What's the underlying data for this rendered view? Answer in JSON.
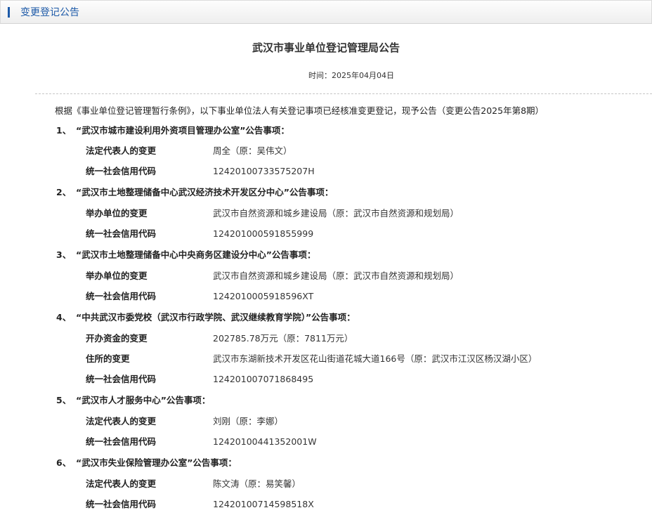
{
  "header": {
    "title": "变更登记公告"
  },
  "article": {
    "title": "武汉市事业单位登记管理局公告",
    "time_label": "时间：",
    "time_value": "2025年04月04日",
    "intro": "根据《事业单位登记管理暂行条例》，以下事业单位法人有关登记事项已经核准变更登记，现予公告（变更公告2025年第8期）",
    "items": [
      {
        "num": "1、",
        "heading": "“武汉市城市建设利用外资项目管理办公室”公告事项：",
        "rows": [
          {
            "label": "法定代表人的变更",
            "value": "周全（原：吴伟文）"
          },
          {
            "label": "统一社会信用代码",
            "value": "12420100733575207H"
          }
        ]
      },
      {
        "num": "2、",
        "heading": "“武汉市土地整理储备中心武汉经济技术开发区分中心”公告事项：",
        "rows": [
          {
            "label": "举办单位的变更",
            "value": "武汉市自然资源和城乡建设局（原：武汉市自然资源和规划局）"
          },
          {
            "label": "统一社会信用代码",
            "value": "124201000591855999"
          }
        ]
      },
      {
        "num": "3、",
        "heading": "“武汉市土地整理储备中心中央商务区建设分中心”公告事项：",
        "rows": [
          {
            "label": "举办单位的变更",
            "value": "武汉市自然资源和城乡建设局（原：武汉市自然资源和规划局）"
          },
          {
            "label": "统一社会信用代码",
            "value": "1242010005918596XT"
          }
        ]
      },
      {
        "num": "4、",
        "heading": "“中共武汉市委党校（武汉市行政学院、武汉继续教育学院）”公告事项：",
        "rows": [
          {
            "label": "开办资金的变更",
            "value": "202785.78万元（原：7811万元）"
          },
          {
            "label": "住所的变更",
            "value": "武汉市东湖新技术开发区花山街道花城大道166号（原：武汉市江汉区杨汉湖小区）"
          },
          {
            "label": "统一社会信用代码",
            "value": "124201007071868495"
          }
        ]
      },
      {
        "num": "5、",
        "heading": "“武汉市人才服务中心”公告事项：",
        "rows": [
          {
            "label": "法定代表人的变更",
            "value": "刘刚（原：李娜）"
          },
          {
            "label": "统一社会信用代码",
            "value": "12420100441352001W"
          }
        ]
      },
      {
        "num": "6、",
        "heading": "“武汉市失业保险管理办公室”公告事项：",
        "rows": [
          {
            "label": "法定代表人的变更",
            "value": "陈文涛（原：易笑馨）"
          },
          {
            "label": "统一社会信用代码",
            "value": "12420100714598518X"
          }
        ]
      }
    ]
  }
}
